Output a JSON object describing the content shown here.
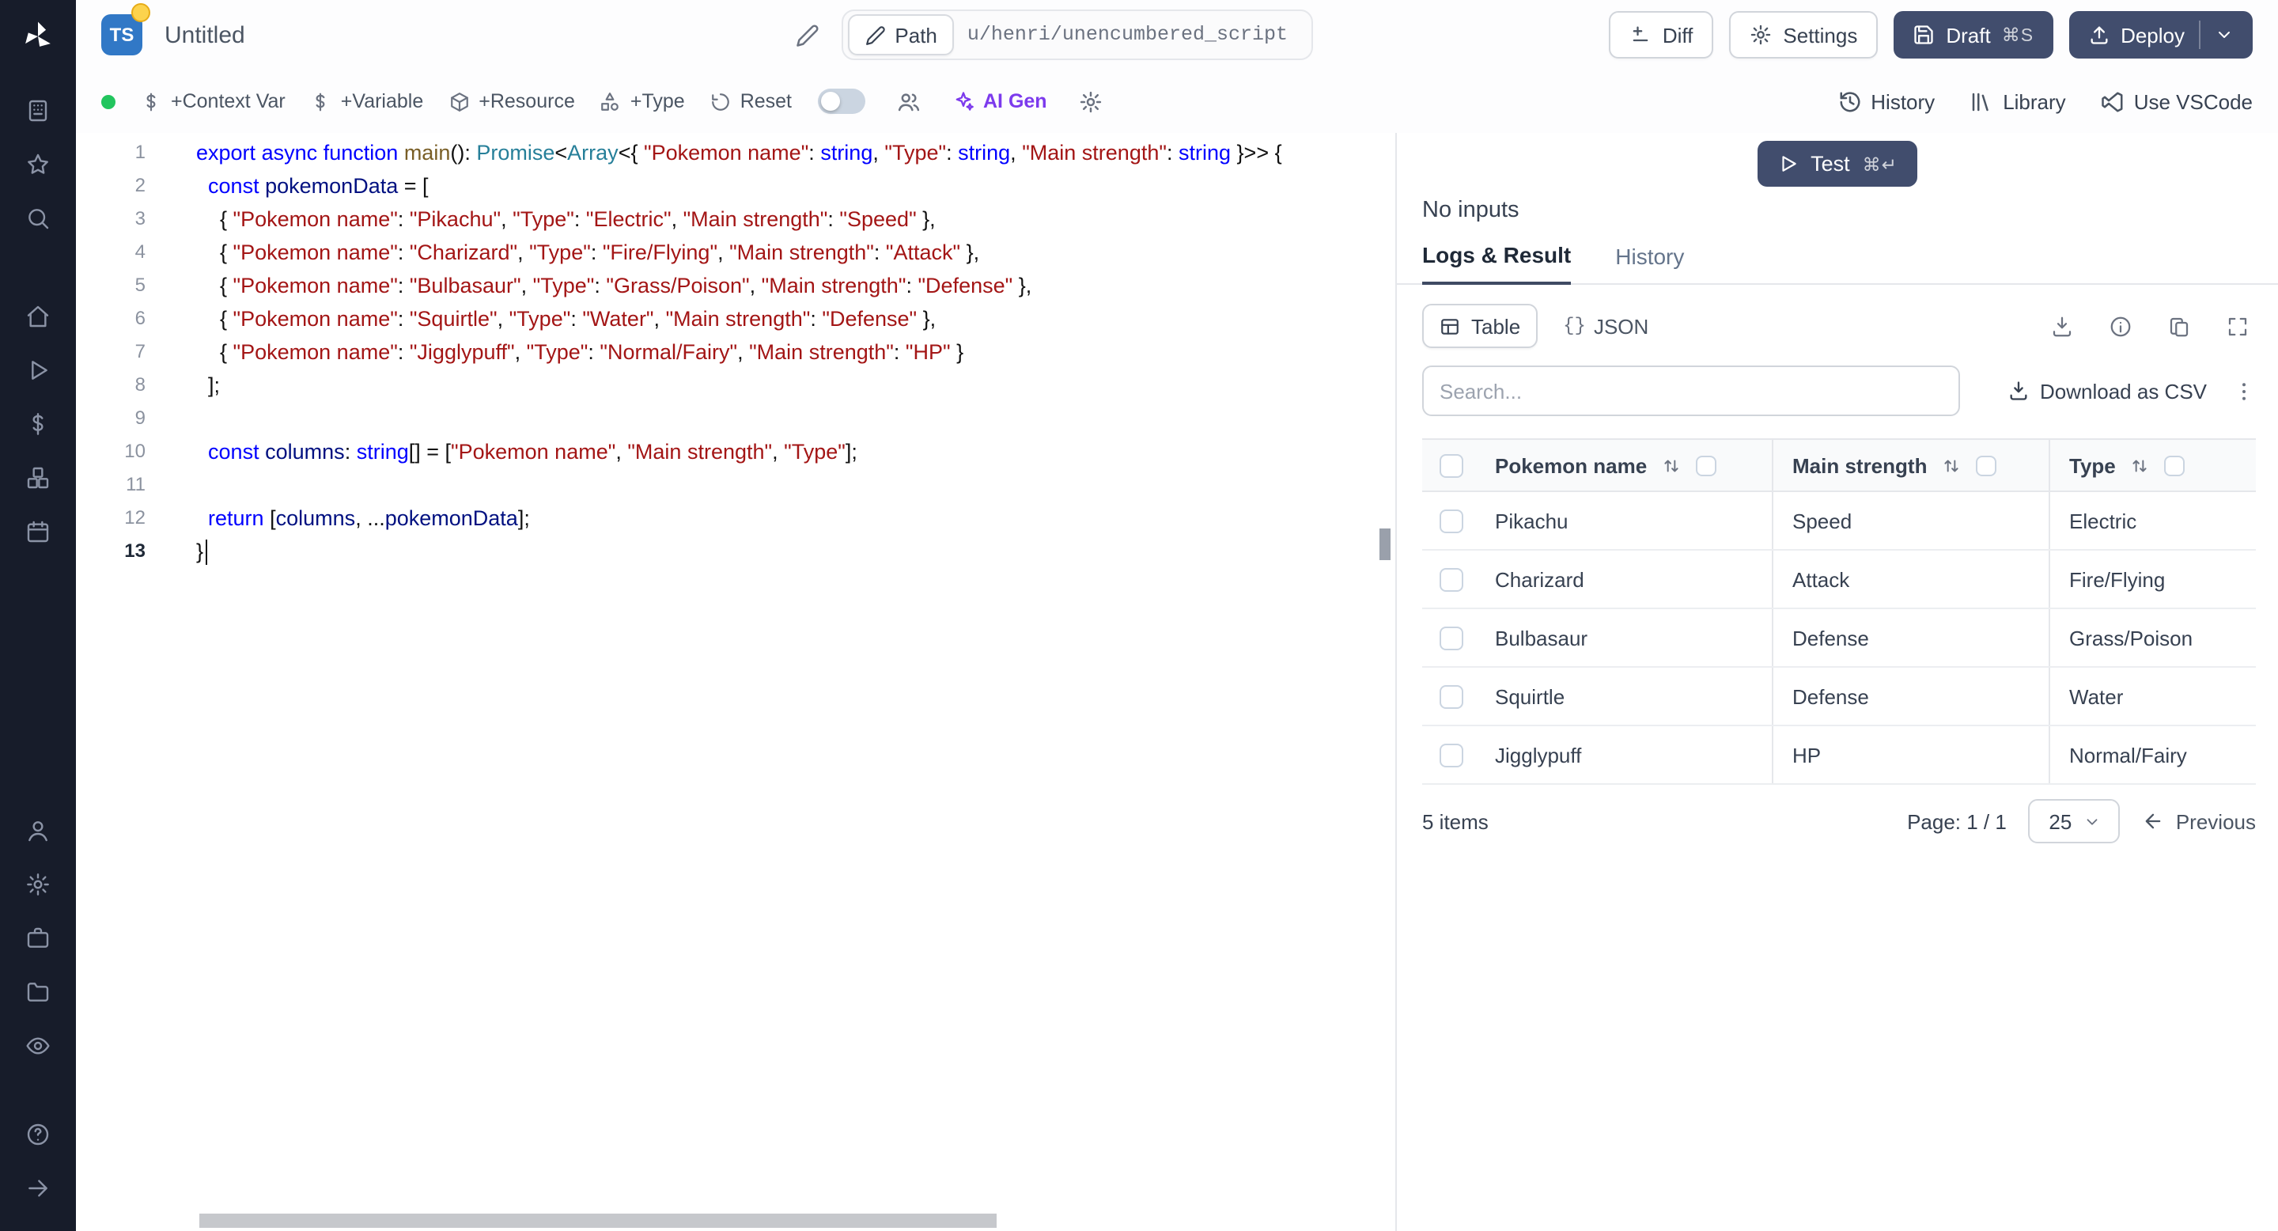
{
  "colors": {
    "primary_dark": "#414d6d",
    "ai_accent": "#7c3aed",
    "status_green": "#22c55e",
    "ts_badge": "#3178c6",
    "keyword": "#0000ff",
    "type": "#267f99",
    "string": "#a31515",
    "variable": "#001080",
    "function": "#795e26"
  },
  "sidebar": {
    "top_icons": [
      "apps",
      "star",
      "search"
    ],
    "nav_icons": [
      "home",
      "play",
      "dollar",
      "boxes",
      "calendar"
    ],
    "admin_icons": [
      "user",
      "gear",
      "briefcase",
      "folder",
      "eye"
    ],
    "bottom_icons": [
      "help",
      "arrow-right"
    ]
  },
  "header": {
    "lang_badge": "TS",
    "title": "Untitled",
    "path_label": "Path",
    "path_value": "u/henri/unencumbered_script",
    "buttons": {
      "diff": "Diff",
      "settings": "Settings",
      "draft": "Draft",
      "draft_kbd": "⌘S",
      "deploy": "Deploy"
    }
  },
  "toolbar": {
    "items": [
      {
        "icon": "dollar",
        "label": "+Context Var"
      },
      {
        "icon": "dollar",
        "label": "+Variable"
      },
      {
        "icon": "package",
        "label": "+Resource"
      },
      {
        "icon": "shapes",
        "label": "+Type"
      },
      {
        "icon": "reset",
        "label": "Reset"
      }
    ],
    "ai_gen_label": "AI Gen",
    "right_items": [
      {
        "icon": "history",
        "label": "History"
      },
      {
        "icon": "library",
        "label": "Library"
      },
      {
        "icon": "vscode",
        "label": "Use VSCode"
      }
    ]
  },
  "editor": {
    "language": "typescript",
    "lines": [
      {
        "n": 1,
        "tokens": [
          [
            "k",
            "export"
          ],
          [
            "p",
            " "
          ],
          [
            "k",
            "async"
          ],
          [
            "p",
            " "
          ],
          [
            "k",
            "function"
          ],
          [
            "p",
            " "
          ],
          [
            "f",
            "main"
          ],
          [
            "p",
            "(): "
          ],
          [
            "t",
            "Promise"
          ],
          [
            "p",
            "<"
          ],
          [
            "t",
            "Array"
          ],
          [
            "p",
            "<{ "
          ],
          [
            "s",
            "\"Pokemon name\""
          ],
          [
            "p",
            ": "
          ],
          [
            "k",
            "string"
          ],
          [
            "p",
            ", "
          ],
          [
            "s",
            "\"Type\""
          ],
          [
            "p",
            ": "
          ],
          [
            "k",
            "string"
          ],
          [
            "p",
            ", "
          ],
          [
            "s",
            "\"Main strength\""
          ],
          [
            "p",
            ": "
          ],
          [
            "k",
            "string"
          ],
          [
            "p",
            " }>> {"
          ]
        ]
      },
      {
        "n": 2,
        "tokens": [
          [
            "p",
            "  "
          ],
          [
            "k",
            "const"
          ],
          [
            "p",
            " "
          ],
          [
            "v",
            "pokemonData"
          ],
          [
            "p",
            " = ["
          ]
        ]
      },
      {
        "n": 3,
        "tokens": [
          [
            "p",
            "    { "
          ],
          [
            "s",
            "\"Pokemon name\""
          ],
          [
            "p",
            ": "
          ],
          [
            "s",
            "\"Pikachu\""
          ],
          [
            "p",
            ", "
          ],
          [
            "s",
            "\"Type\""
          ],
          [
            "p",
            ": "
          ],
          [
            "s",
            "\"Electric\""
          ],
          [
            "p",
            ", "
          ],
          [
            "s",
            "\"Main strength\""
          ],
          [
            "p",
            ": "
          ],
          [
            "s",
            "\"Speed\""
          ],
          [
            "p",
            " },"
          ]
        ]
      },
      {
        "n": 4,
        "tokens": [
          [
            "p",
            "    { "
          ],
          [
            "s",
            "\"Pokemon name\""
          ],
          [
            "p",
            ": "
          ],
          [
            "s",
            "\"Charizard\""
          ],
          [
            "p",
            ", "
          ],
          [
            "s",
            "\"Type\""
          ],
          [
            "p",
            ": "
          ],
          [
            "s",
            "\"Fire/Flying\""
          ],
          [
            "p",
            ", "
          ],
          [
            "s",
            "\"Main strength\""
          ],
          [
            "p",
            ": "
          ],
          [
            "s",
            "\"Attack\""
          ],
          [
            "p",
            " },"
          ]
        ]
      },
      {
        "n": 5,
        "tokens": [
          [
            "p",
            "    { "
          ],
          [
            "s",
            "\"Pokemon name\""
          ],
          [
            "p",
            ": "
          ],
          [
            "s",
            "\"Bulbasaur\""
          ],
          [
            "p",
            ", "
          ],
          [
            "s",
            "\"Type\""
          ],
          [
            "p",
            ": "
          ],
          [
            "s",
            "\"Grass/Poison\""
          ],
          [
            "p",
            ", "
          ],
          [
            "s",
            "\"Main strength\""
          ],
          [
            "p",
            ": "
          ],
          [
            "s",
            "\"Defense\""
          ],
          [
            "p",
            " },"
          ]
        ]
      },
      {
        "n": 6,
        "tokens": [
          [
            "p",
            "    { "
          ],
          [
            "s",
            "\"Pokemon name\""
          ],
          [
            "p",
            ": "
          ],
          [
            "s",
            "\"Squirtle\""
          ],
          [
            "p",
            ", "
          ],
          [
            "s",
            "\"Type\""
          ],
          [
            "p",
            ": "
          ],
          [
            "s",
            "\"Water\""
          ],
          [
            "p",
            ", "
          ],
          [
            "s",
            "\"Main strength\""
          ],
          [
            "p",
            ": "
          ],
          [
            "s",
            "\"Defense\""
          ],
          [
            "p",
            " },"
          ]
        ]
      },
      {
        "n": 7,
        "tokens": [
          [
            "p",
            "    { "
          ],
          [
            "s",
            "\"Pokemon name\""
          ],
          [
            "p",
            ": "
          ],
          [
            "s",
            "\"Jigglypuff\""
          ],
          [
            "p",
            ", "
          ],
          [
            "s",
            "\"Type\""
          ],
          [
            "p",
            ": "
          ],
          [
            "s",
            "\"Normal/Fairy\""
          ],
          [
            "p",
            ", "
          ],
          [
            "s",
            "\"Main strength\""
          ],
          [
            "p",
            ": "
          ],
          [
            "s",
            "\"HP\""
          ],
          [
            "p",
            " }"
          ]
        ]
      },
      {
        "n": 8,
        "tokens": [
          [
            "p",
            "  ];"
          ]
        ]
      },
      {
        "n": 9,
        "tokens": []
      },
      {
        "n": 10,
        "tokens": [
          [
            "p",
            "  "
          ],
          [
            "k",
            "const"
          ],
          [
            "p",
            " "
          ],
          [
            "v",
            "columns"
          ],
          [
            "p",
            ": "
          ],
          [
            "k",
            "string"
          ],
          [
            "p",
            "[] = ["
          ],
          [
            "s",
            "\"Pokemon name\""
          ],
          [
            "p",
            ", "
          ],
          [
            "s",
            "\"Main strength\""
          ],
          [
            "p",
            ", "
          ],
          [
            "s",
            "\"Type\""
          ],
          [
            "p",
            "];"
          ]
        ]
      },
      {
        "n": 11,
        "tokens": []
      },
      {
        "n": 12,
        "tokens": [
          [
            "p",
            "  "
          ],
          [
            "k",
            "return"
          ],
          [
            "p",
            " ["
          ],
          [
            "v",
            "columns"
          ],
          [
            "p",
            ", ..."
          ],
          [
            "v",
            "pokemonData"
          ],
          [
            "p",
            "];"
          ]
        ]
      },
      {
        "n": 13,
        "active": true,
        "cursor": true,
        "tokens": [
          [
            "p",
            "}"
          ]
        ]
      }
    ]
  },
  "run": {
    "test_label": "Test",
    "test_kbd": "⌘↵",
    "no_inputs": "No inputs",
    "tabs": [
      "Logs & Result",
      "History"
    ],
    "active_tab": "Logs & Result"
  },
  "result": {
    "view_toggle": {
      "table": "Table",
      "json_prefix": "{}",
      "json": "JSON"
    },
    "search_placeholder": "Search...",
    "search_value": "",
    "download_csv": "Download as CSV",
    "table": {
      "columns": [
        "Pokemon name",
        "Main strength",
        "Type"
      ],
      "rows": [
        [
          "Pikachu",
          "Speed",
          "Electric"
        ],
        [
          "Charizard",
          "Attack",
          "Fire/Flying"
        ],
        [
          "Bulbasaur",
          "Defense",
          "Grass/Poison"
        ],
        [
          "Squirtle",
          "Defense",
          "Water"
        ],
        [
          "Jigglypuff",
          "HP",
          "Normal/Fairy"
        ]
      ]
    },
    "footer": {
      "items": "5 items",
      "page": "Page: 1 / 1",
      "page_size": "25",
      "previous": "Previous"
    }
  }
}
